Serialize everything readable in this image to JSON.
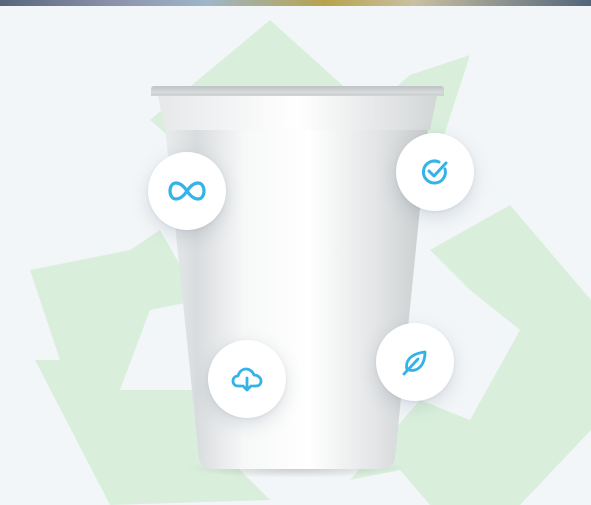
{
  "scene": {
    "background_color": "#f3f6f8",
    "recycle_symbol_color": "#d9efdc",
    "icon_color": "#33b3e8"
  },
  "badges": [
    {
      "icon": "infinity-icon"
    },
    {
      "icon": "check-circle-icon"
    },
    {
      "icon": "cloud-download-icon"
    },
    {
      "icon": "leaf-icon"
    }
  ]
}
